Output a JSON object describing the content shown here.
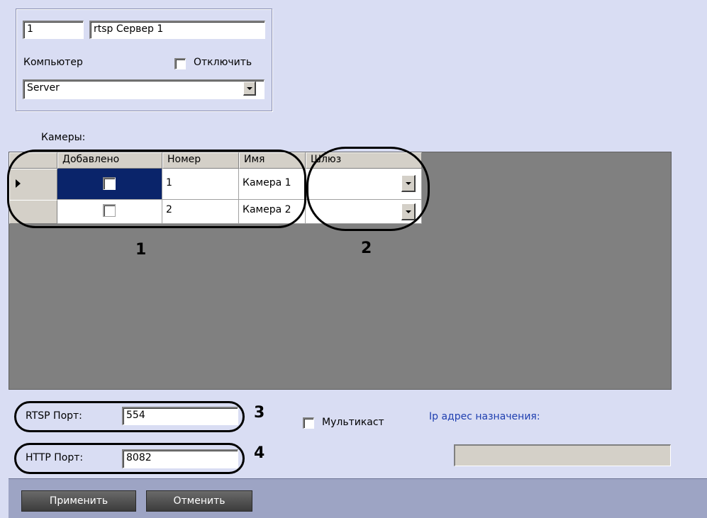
{
  "object": {
    "id": "1",
    "name": "rtsp Сервер 1",
    "computer_label": "Компьютер",
    "disable_label": "Отключить",
    "computer_value": "Server"
  },
  "cameras": {
    "label": "Камеры:",
    "columns": [
      "Добавлено",
      "Номер",
      "Имя",
      "Шлюз"
    ],
    "rows": [
      {
        "added": false,
        "number": "1",
        "name": "Камера 1",
        "gateway": ""
      },
      {
        "added": false,
        "number": "2",
        "name": "Камера 2",
        "gateway": ""
      }
    ]
  },
  "callouts": {
    "c1": "1",
    "c2": "2",
    "c3": "3",
    "c4": "4"
  },
  "ports": {
    "rtsp_label": "RTSP Порт:",
    "rtsp_value": "554",
    "http_label": "HTTP Порт:",
    "http_value": "8082",
    "multicast_label": "Мультикаст",
    "ip_label": "Ip адрес назначения:",
    "ip_value": ""
  },
  "footer": {
    "apply_label": "Применить",
    "cancel_label": "Отменить"
  },
  "colors": {
    "background": "#d9ddf3",
    "grid_background": "#808080",
    "selected_cell": "#0a246a",
    "ip_label_color": "#1f3fb0"
  }
}
